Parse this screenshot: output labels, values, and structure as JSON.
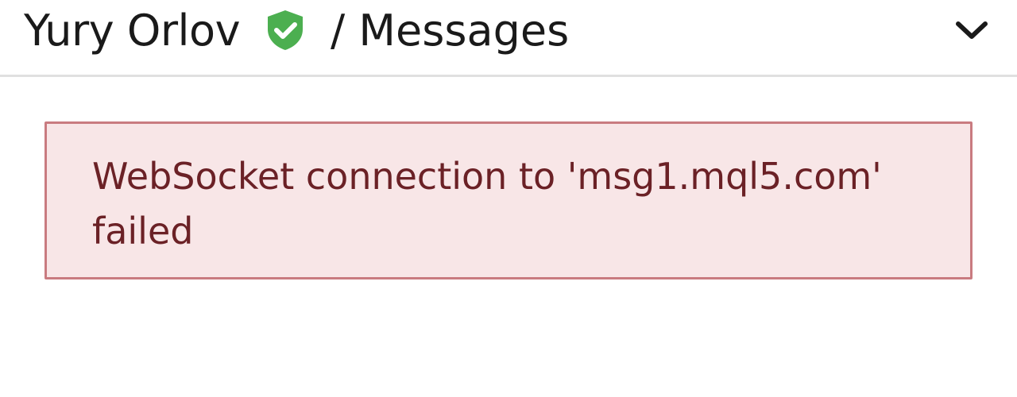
{
  "header": {
    "user_name": "Yury Orlov",
    "section_title": "/ Messages",
    "verified_icon": "shield-check-icon",
    "menu_icon": "chevron-down-icon"
  },
  "alert": {
    "message": "WebSocket connection to 'msg1.mql5.com' failed",
    "background_color": "#f8e6e7",
    "border_color": "#c97b80",
    "text_color": "#6b2126"
  },
  "colors": {
    "verified_green": "#4caf50"
  }
}
